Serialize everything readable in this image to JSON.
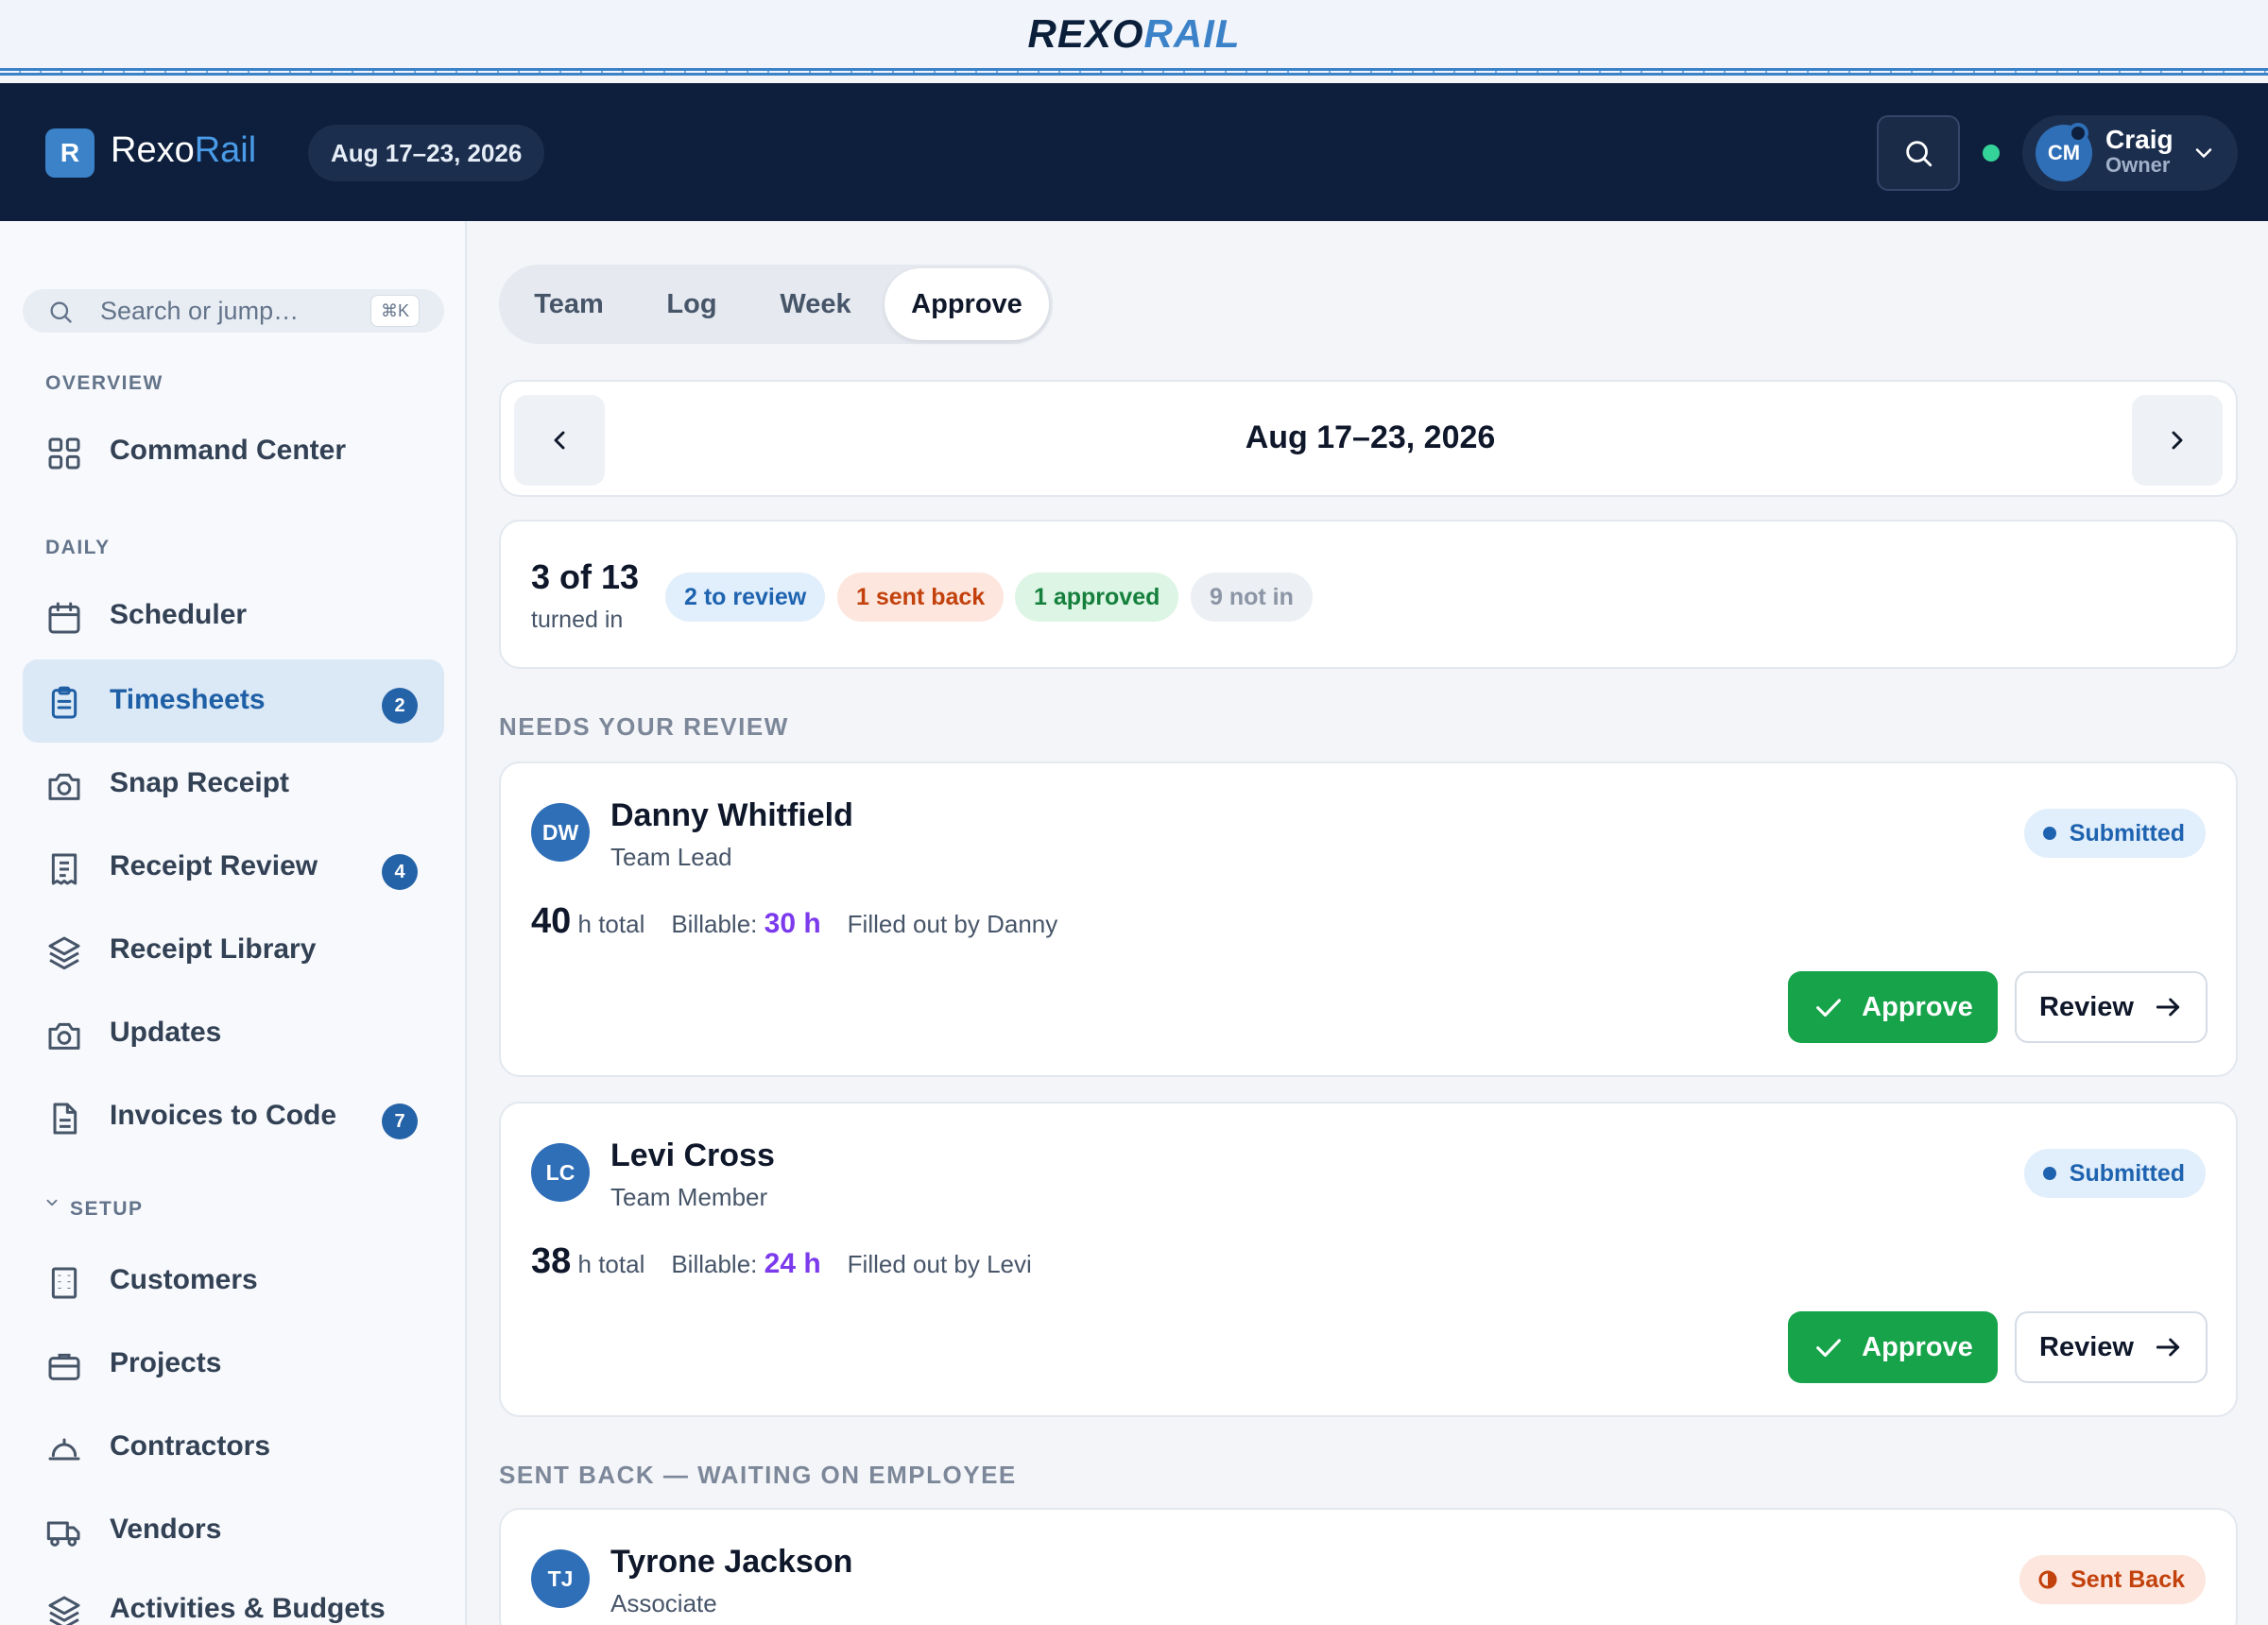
{
  "brand": {
    "word_a": "REXO",
    "word_b": "RAIL"
  },
  "header": {
    "logo_letter": "R",
    "app_name_a": "Rexo",
    "app_name_b": "Rail",
    "date_range": "Aug 17–23, 2026",
    "user": {
      "initials": "CM",
      "name": "Craig",
      "role": "Owner"
    },
    "status_color": "#34d399"
  },
  "sidebar": {
    "search_placeholder": "Search or jump…",
    "search_shortcut": "⌘K",
    "sections": {
      "overview": "OVERVIEW",
      "daily": "DAILY",
      "setup": "SETUP"
    },
    "items": [
      {
        "label": "Command Center",
        "icon": "grid-icon"
      },
      {
        "label": "Scheduler",
        "icon": "calendar-icon"
      },
      {
        "label": "Timesheets",
        "icon": "clipboard-icon",
        "count": "2",
        "active": true
      },
      {
        "label": "Snap Receipt",
        "icon": "camera-icon"
      },
      {
        "label": "Receipt Review",
        "icon": "receipt-icon",
        "count": "4"
      },
      {
        "label": "Receipt Library",
        "icon": "layers-icon"
      },
      {
        "label": "Updates",
        "icon": "camera-icon"
      },
      {
        "label": "Invoices to Code",
        "icon": "file-icon",
        "count": "7"
      },
      {
        "label": "Customers",
        "icon": "building-icon"
      },
      {
        "label": "Projects",
        "icon": "briefcase-icon"
      },
      {
        "label": "Contractors",
        "icon": "hardhat-icon"
      },
      {
        "label": "Vendors",
        "icon": "truck-icon"
      },
      {
        "label": "Activities & Budgets",
        "icon": "layers-icon"
      }
    ]
  },
  "tabs": [
    "Team",
    "Log",
    "Week",
    "Approve"
  ],
  "active_tab": "Approve",
  "week_nav": {
    "title": "Aug 17–23, 2026"
  },
  "summary": {
    "count": "3 of 13",
    "caption": "turned in",
    "chips": [
      {
        "label": "2 to review",
        "bg": "#e1eefb",
        "color": "#1e63b0"
      },
      {
        "label": "1 sent back",
        "bg": "#fde6dd",
        "color": "#c2410c"
      },
      {
        "label": "1 approved",
        "bg": "#dcf5e4",
        "color": "#15803d"
      },
      {
        "label": "9 not in",
        "bg": "#eceff3",
        "color": "#8b95a5"
      }
    ]
  },
  "sections": {
    "review": "NEEDS YOUR REVIEW",
    "sent_back": "SENT BACK — WAITING ON EMPLOYEE"
  },
  "cards": [
    {
      "initials": "DW",
      "name": "Danny Whitfield",
      "role": "Team Lead",
      "status": "Submitted",
      "hours": "40",
      "hours_unit": "h total",
      "billable_label": "Billable:",
      "billable": "30 h",
      "filled_by": "Filled out by Danny",
      "approve_label": "Approve",
      "review_label": "Review"
    },
    {
      "initials": "LC",
      "name": "Levi Cross",
      "role": "Team Member",
      "status": "Submitted",
      "hours": "38",
      "hours_unit": "h total",
      "billable_label": "Billable:",
      "billable": "24 h",
      "filled_by": "Filled out by Levi",
      "approve_label": "Approve",
      "review_label": "Review"
    },
    {
      "initials": "TJ",
      "name": "Tyrone Jackson",
      "role": "Associate",
      "status": "Sent Back"
    }
  ]
}
